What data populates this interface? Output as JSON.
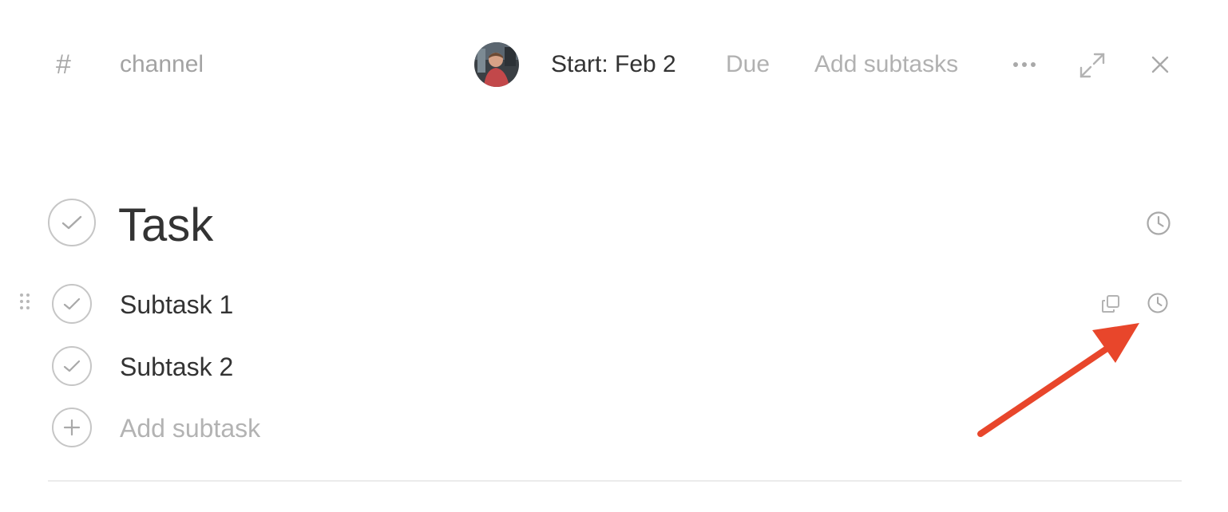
{
  "header": {
    "channel_icon": "hash-icon",
    "channel_label": "channel",
    "start_label": "Start: Feb 2",
    "due_label": "Due",
    "add_subtasks_label": "Add subtasks",
    "more_icon": "more-horizontal-icon",
    "expand_icon": "expand-icon",
    "close_icon": "close-icon"
  },
  "task": {
    "title": "Task",
    "subtasks": [
      {
        "label": "Subtask 1"
      },
      {
        "label": "Subtask 2"
      }
    ],
    "add_subtask_placeholder": "Add subtask"
  },
  "annotation": {
    "arrow_color": "#e8462b",
    "target": "subtask-clock-icon"
  },
  "colors": {
    "text": "#333333",
    "muted": "#b1b1b1",
    "icon": "#a9a9a9",
    "accent_arrow": "#e8462b"
  }
}
